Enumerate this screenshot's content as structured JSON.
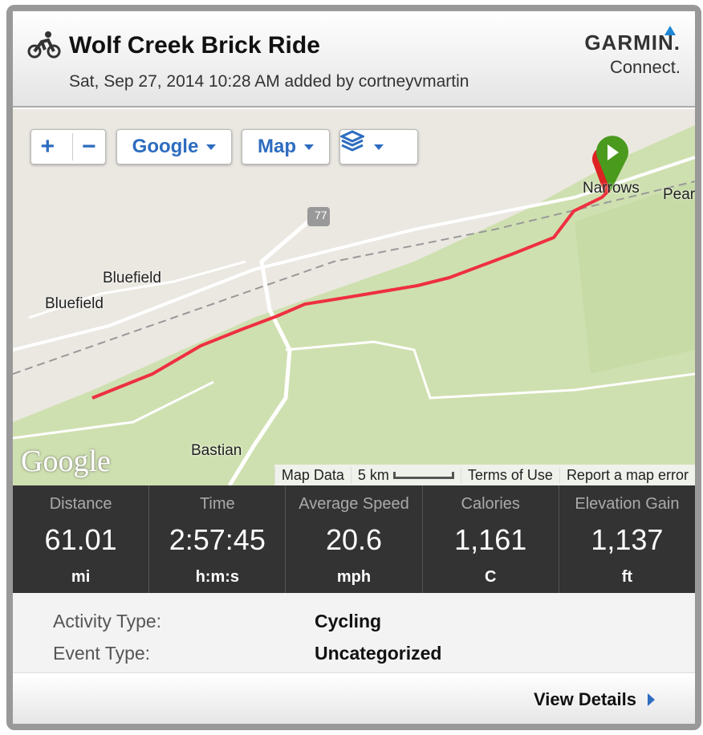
{
  "header": {
    "title": "Wolf Creek Brick Ride",
    "subtitle": "Sat, Sep 27, 2014 10:28 AM added by cortneyvmartin",
    "logo_line1": "GARMIN.",
    "logo_line2": "Connect."
  },
  "map": {
    "zoom_in": "+",
    "zoom_out": "−",
    "provider": "Google",
    "type": "Map",
    "labels": {
      "narrows": "Narrows",
      "pear": "Pear",
      "bluefield1": "Bluefield",
      "bluefield2": "Bluefield",
      "bastian": "Bastian",
      "highway": "77"
    },
    "google_logo": "Google",
    "attribution": {
      "map_data": "Map Data",
      "scale": "5 km",
      "terms": "Terms of Use",
      "report": "Report a map error"
    },
    "route_color": "#ee3040"
  },
  "stats": [
    {
      "label": "Distance",
      "value": "61.01",
      "unit": "mi"
    },
    {
      "label": "Time",
      "value": "2:57:45",
      "unit": "h:m:s"
    },
    {
      "label": "Average Speed",
      "value": "20.6",
      "unit": "mph"
    },
    {
      "label": "Calories",
      "value": "1,161",
      "unit": "C"
    },
    {
      "label": "Elevation Gain",
      "value": "1,137",
      "unit": "ft"
    }
  ],
  "details": {
    "activity_type_label": "Activity Type:",
    "activity_type": "Cycling",
    "event_type_label": "Event Type:",
    "event_type": "Uncategorized"
  },
  "footer": {
    "view_details": "View Details"
  }
}
